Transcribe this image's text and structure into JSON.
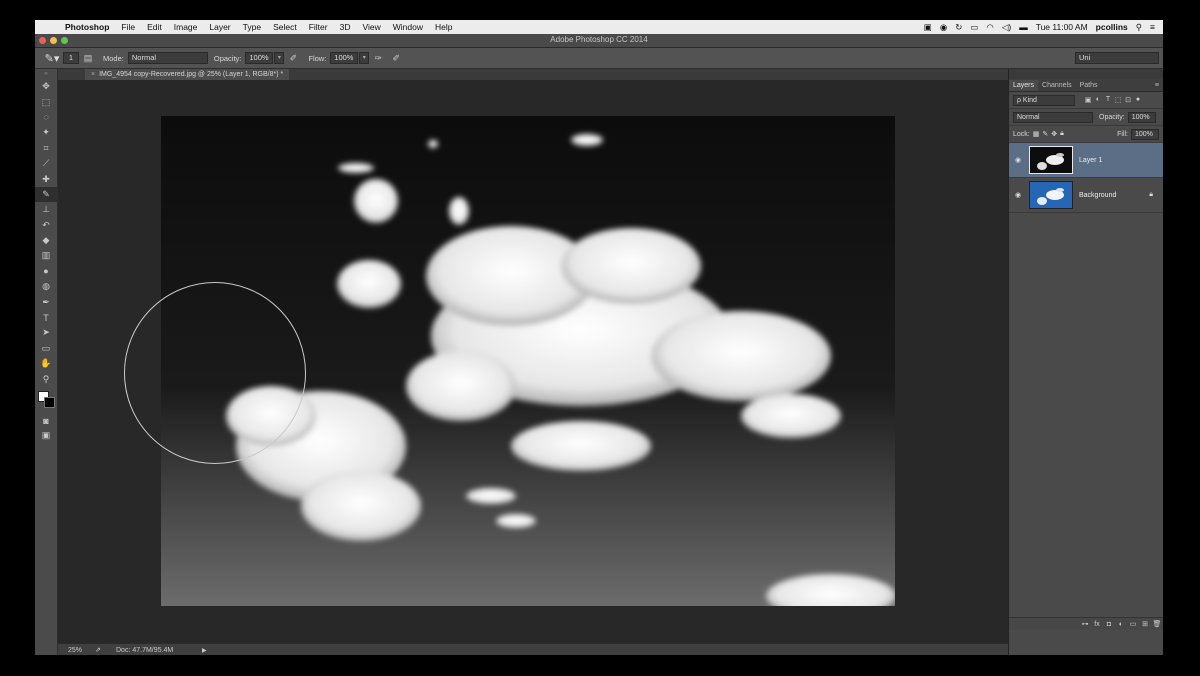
{
  "menubar": {
    "apple_glyph": "",
    "app_name": "Photoshop",
    "menus": [
      "File",
      "Edit",
      "Image",
      "Layer",
      "Type",
      "Select",
      "Filter",
      "3D",
      "View",
      "Window",
      "Help"
    ],
    "clock": "Tue 11:00 AM",
    "user": "pcollins"
  },
  "titlebar": {
    "title": "Adobe Photoshop CC 2014"
  },
  "options": {
    "brush_size": "1",
    "mode_label": "Mode:",
    "mode_value": "Normal",
    "opacity_label": "Opacity:",
    "opacity_value": "100%",
    "flow_label": "Flow:",
    "flow_value": "100%",
    "workspace_value": "Uni"
  },
  "document": {
    "tab_close": "×",
    "tab_title": "IMG_4954 copy-Recovered.jpg @ 25% (Layer 1, RGB/8*) *"
  },
  "status": {
    "zoom": "25%",
    "doc_size": "Doc: 47.7M/95.4M"
  },
  "layers_panel": {
    "tabs": [
      "Layers",
      "Channels",
      "Paths"
    ],
    "filter_kind": "ρ Kind",
    "blend_mode": "Normal",
    "opacity_label": "Opacity:",
    "opacity_value": "100%",
    "lock_label": "Lock:",
    "fill_label": "Fill:",
    "fill_value": "100%",
    "layers": [
      {
        "name": "Layer 1",
        "selected": true
      },
      {
        "name": "Background",
        "locked": true
      }
    ]
  },
  "colors": {
    "selected_layer": "#5b6e85",
    "close_light": "#ed5f57",
    "minimize_light": "#f5be4f",
    "zoom_light": "#61c554",
    "background_thumb": "#2766b5"
  },
  "icons": {
    "tools": [
      "move-icon",
      "marquee-icon",
      "lasso-icon",
      "quick-select-icon",
      "crop-icon",
      "eyedropper-icon",
      "healing-brush-icon",
      "brush-icon",
      "clone-stamp-icon",
      "history-brush-icon",
      "eraser-icon",
      "gradient-icon",
      "blur-icon",
      "dodge-icon",
      "pen-icon",
      "type-icon",
      "path-select-icon",
      "rectangle-icon",
      "hand-icon",
      "zoom-icon"
    ]
  }
}
